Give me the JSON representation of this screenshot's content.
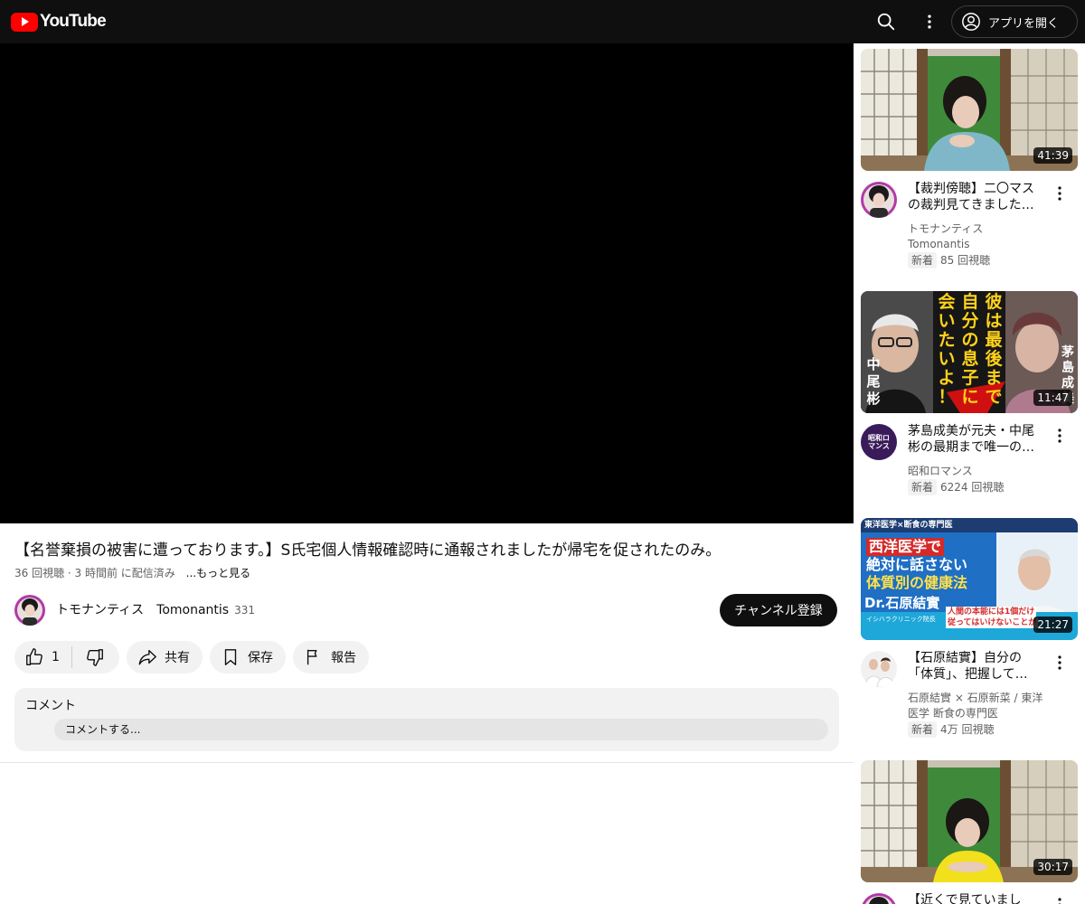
{
  "header": {
    "logo_text": "YouTube",
    "open_app_label": "アプリを開く",
    "icons": {
      "search": "search-icon",
      "more": "more-vert-icon",
      "account": "account-circle-icon"
    }
  },
  "video": {
    "title": "【名誉棄損の被害に遭っております。】S氏宅個人情報確認時に通報されましたが帰宅を促されたのみ。",
    "meta": "36 回視聴 · 3 時間前 に配信済み",
    "more_label": "...もっと見る",
    "channel_name": "トモナンティス　Tomonantis",
    "subscribers": "331",
    "subscribe_label": "チャンネル登録"
  },
  "actions": {
    "like_count": "1",
    "share_label": "共有",
    "save_label": "保存",
    "report_label": "報告"
  },
  "comments": {
    "header": "コメント",
    "placeholder": "コメントする..."
  },
  "recommendations": [
    {
      "duration": "41:39",
      "title_lines": [
        "【裁判傍聴】二〇マス",
        "の裁判見てきました…"
      ],
      "channel_lines": [
        "トモナンティス",
        "Tomonantis"
      ],
      "badge": "新着",
      "views": "85 回視聴"
    },
    {
      "duration": "11:47",
      "title_lines": [
        "茅島成美が元夫・中尾",
        "彬の最期まで唯一の…"
      ],
      "channel_lines": [
        "昭和ロマンス"
      ],
      "badge": "新着",
      "views": "6224 回視聴"
    },
    {
      "duration": "21:27",
      "title_lines": [
        "【石原結實】自分の",
        "「体質」、把握して…"
      ],
      "channel_lines": [
        "石原結實 × 石原新菜 / 東洋",
        "医学 断食の専門医"
      ],
      "badge": "新着",
      "views": "4万 回視聴"
    },
    {
      "duration": "30:17",
      "title_lines": [
        "【近くで見ていまし",
        ""
      ],
      "channel_lines": [],
      "badge": "",
      "views": ""
    }
  ],
  "thumb_text": {
    "rec2": {
      "big": [
        "彼",
        "は",
        "最",
        "後",
        "ま",
        "で",
        "自",
        "分",
        "の",
        "息",
        "子",
        "に",
        "会",
        "い",
        "た",
        "い",
        "よ",
        "！"
      ],
      "left_name": [
        "中",
        "尾",
        "彬"
      ],
      "right_name": [
        "茅",
        "島",
        "成",
        "美"
      ]
    },
    "rec3": {
      "top": "東洋医学×断食の専門医",
      "line1": "西洋医学で",
      "line2": "絶対に話さない",
      "line3": "体質別の健康法",
      "name": "Dr.石原結實",
      "sub": "イシハラクリニック院長",
      "note1": "人間の本能には1個だけ",
      "note2": "従ってはいけないことが"
    },
    "avatar2": "昭和ロマンス"
  },
  "colors": {
    "brand_red": "#ff0000",
    "header_bg": "#0f0f0f",
    "pill_bg": "#f2f2f2",
    "secondary_text": "#606060"
  }
}
